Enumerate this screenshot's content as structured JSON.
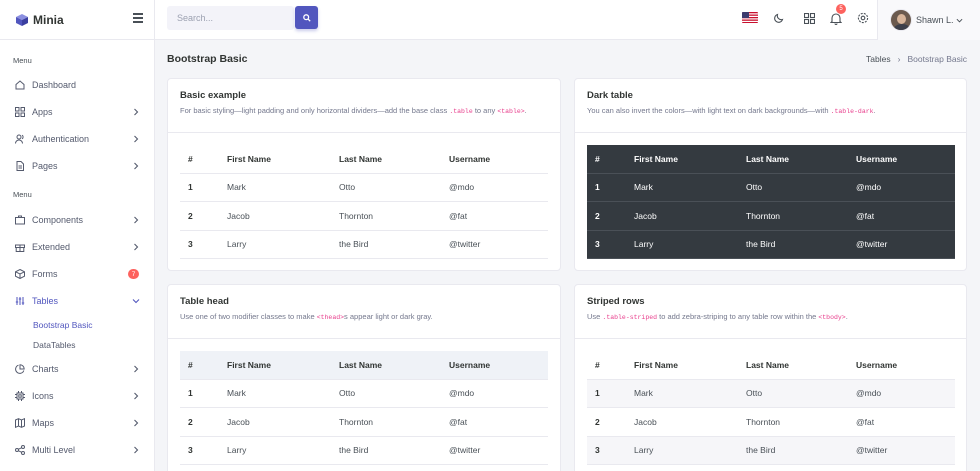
{
  "brand": {
    "name": "Minia"
  },
  "search": {
    "placeholder": "Search..."
  },
  "user": {
    "name": "Shawn L.",
    "notification_count": "5"
  },
  "sidebar": {
    "menu_title_1": "Menu",
    "menu_title_2": "Menu",
    "items": [
      {
        "label": "Dashboard",
        "icon": "home-icon"
      },
      {
        "label": "Apps",
        "icon": "grid-icon"
      },
      {
        "label": "Authentication",
        "icon": "users-icon"
      },
      {
        "label": "Pages",
        "icon": "file-icon"
      },
      {
        "label": "Components",
        "icon": "briefcase-icon"
      },
      {
        "label": "Extended",
        "icon": "gift-icon"
      },
      {
        "label": "Forms",
        "icon": "box-icon",
        "badge": "7"
      },
      {
        "label": "Tables",
        "icon": "sliders-icon"
      },
      {
        "label": "Charts",
        "icon": "pie-chart-icon"
      },
      {
        "label": "Icons",
        "icon": "cpu-icon"
      },
      {
        "label": "Maps",
        "icon": "map-icon"
      },
      {
        "label": "Multi Level",
        "icon": "share-icon"
      }
    ],
    "tables_sub": [
      "Bootstrap Basic",
      "DataTables"
    ]
  },
  "page": {
    "title": "Bootstrap Basic",
    "breadcrumb": [
      "Tables",
      "Bootstrap Basic"
    ]
  },
  "cards": {
    "basic": {
      "title": "Basic example",
      "desc_pre": "For basic styling—light padding and only horizontal dividers—add the base class ",
      "code1": ".table",
      "desc_mid": " to any ",
      "code2": "<table>",
      "desc_post": "."
    },
    "dark": {
      "title": "Dark table",
      "desc_pre": "You can also invert the colors—with light text on dark backgrounds—with ",
      "code1": ".table-dark",
      "desc_post": "."
    },
    "head": {
      "title": "Table head",
      "desc_pre": "Use one of two modifier classes to make ",
      "code1": "<thead>",
      "desc_post": "s appear light or dark gray."
    },
    "striped": {
      "title": "Striped rows",
      "desc_pre": "Use ",
      "code1": ".table-striped",
      "desc_mid": " to add zebra-striping to any table row within the ",
      "code2": "<tbody>",
      "desc_post": "."
    }
  },
  "table": {
    "headers": [
      "#",
      "First Name",
      "Last Name",
      "Username"
    ],
    "rows": [
      [
        "1",
        "Mark",
        "Otto",
        "@mdo"
      ],
      [
        "2",
        "Jacob",
        "Thornton",
        "@fat"
      ],
      [
        "3",
        "Larry",
        "the Bird",
        "@twitter"
      ]
    ]
  },
  "colors": {
    "accent": "#5156be",
    "danger": "#fd625e",
    "dark_table": "#343a40"
  }
}
